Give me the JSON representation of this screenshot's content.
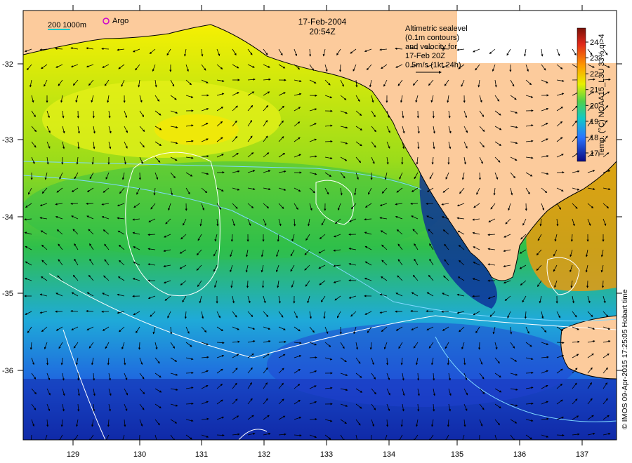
{
  "map": {
    "date": "17-Feb-2004",
    "time": "20:54Z",
    "scale_label": "200  1000m",
    "argo_label": "Argo",
    "velocity_note": [
      "Altimetric sealevel",
      "(0.1m contours)",
      "and velocity for",
      "17-Feb 20Z",
      "0.5m/s (1kt 24h)"
    ],
    "credit": "© IMOS 09-Apr-2015 17:25:05 Hobart time",
    "colorbar_label": "Temp. (°C) NOAA15_L3U 33% qi>4",
    "colorbar_ticks": [
      "17",
      "18",
      "19",
      "20",
      "21",
      "22",
      "23",
      "24"
    ],
    "lon_ticks": [
      "129",
      "130",
      "131",
      "132",
      "133",
      "134",
      "135",
      "136",
      "137"
    ],
    "lat_ticks": [
      "-32",
      "-33",
      "-34",
      "-35",
      "-36"
    ],
    "colors": {
      "land": "#fccb9c",
      "coast": "#000000",
      "contour": "#ffffff",
      "isobath": "#7fd8ff",
      "argo": "#cc00cc"
    }
  }
}
